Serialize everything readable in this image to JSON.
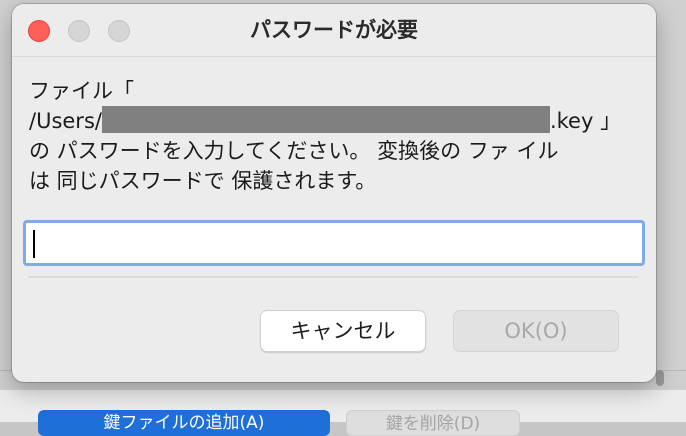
{
  "window": {
    "title": "パスワードが必要"
  },
  "message": {
    "line1": "ファイル「",
    "path_prefix": "/Users/",
    "path_suffix": ".key 」",
    "line3": "の パスワードを入力してください。 変換後の ファ イル",
    "line4": "は 同じパスワードで 保護されます。"
  },
  "password_input": {
    "value": ""
  },
  "buttons": {
    "cancel_label": "キャンセル",
    "ok_label": "OK(O)"
  },
  "background": {
    "primary_button_label": "鍵ファイルの追加(A)",
    "secondary_button_label": "鍵を削除(D)"
  },
  "colors": {
    "close": "#fe5f57",
    "focus_ring": "#7fa9e8",
    "primary": "#1f6fd9"
  }
}
